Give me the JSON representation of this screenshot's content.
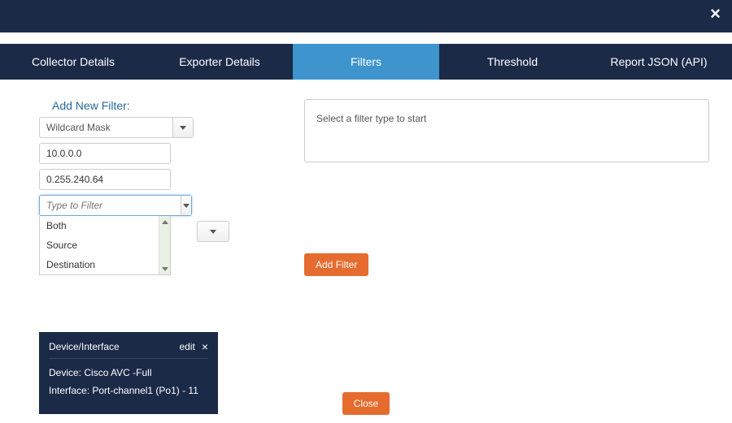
{
  "tabs": {
    "collector": "Collector Details",
    "exporter": "Exporter Details",
    "filters": "Filters",
    "threshold": "Threshold",
    "report": "Report JSON (API)"
  },
  "filter": {
    "section_label": "Add New Filter:",
    "mask_select": "Wildcard Mask",
    "ip1": "10.0.0.0",
    "ip2": "0.255.240.64",
    "type_placeholder": "Type to Filter",
    "options": {
      "both": "Both",
      "source": "Source",
      "destination": "Destination"
    }
  },
  "right": {
    "placeholder": "Select a filter type to start",
    "add_btn": "Add Filter"
  },
  "card": {
    "title": "Device/Interface",
    "edit": "edit",
    "device_label": "Device: ",
    "device_value": "Cisco AVC -Full",
    "iface_label": "Interface: ",
    "iface_value": "Port-channel1 (Po1) - 11"
  },
  "footer": {
    "close": "Close"
  }
}
